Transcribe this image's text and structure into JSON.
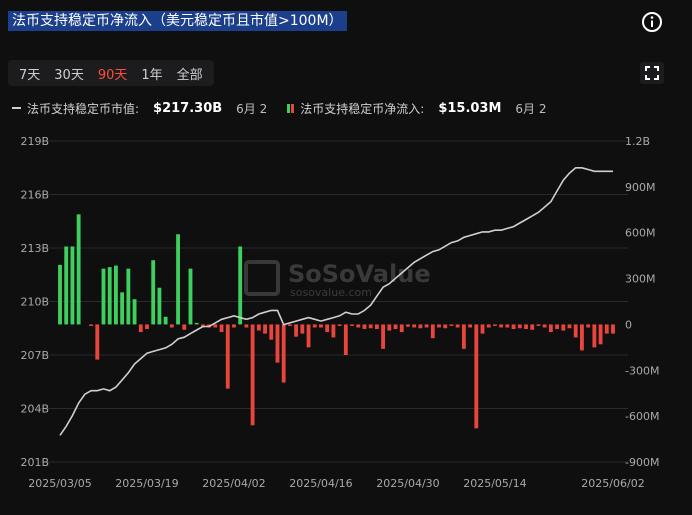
{
  "title": "法币支持稳定币净流入（美元稳定币且市值>100M）",
  "icons": {
    "info": "info-icon",
    "fullscreen": "fullscreen-icon"
  },
  "tabs": [
    {
      "label": "7天",
      "active": false
    },
    {
      "label": "30天",
      "active": false
    },
    {
      "label": "90天",
      "active": true
    },
    {
      "label": "1年",
      "active": false
    },
    {
      "label": "全部",
      "active": false
    }
  ],
  "legend": {
    "marketcap": {
      "label": "法币支持稳定币市值:",
      "value": "$217.30B",
      "date": "6月 2"
    },
    "netflow": {
      "label": "法币支持稳定币净流入:",
      "value": "$15.03M",
      "date": "6月 2"
    }
  },
  "watermark": {
    "brand": "SoSoValue",
    "url": "sosovalue.com"
  },
  "colors": {
    "positive": "#3ecf5e",
    "negative": "#e8453c",
    "line": "#cfcfcf",
    "accent": "#ff4d3a"
  },
  "chart_data": {
    "type": "bar",
    "left_axis": {
      "unit": "B",
      "ylim": [
        201,
        219
      ],
      "ticks": [
        "201B",
        "204B",
        "207B",
        "210B",
        "213B",
        "216B",
        "219B"
      ]
    },
    "right_axis": {
      "unit": "M",
      "ylim": [
        -900,
        1200
      ],
      "ticks": [
        "-900M",
        "-600M",
        "-300M",
        "0",
        "300M",
        "600M",
        "900M",
        "1.2B"
      ]
    },
    "x_ticks": [
      "2025/03/05",
      "2025/03/19",
      "2025/04/02",
      "2025/04/16",
      "2025/04/30",
      "2025/05/14",
      "2025/06/02"
    ],
    "tick_positions": [
      0,
      14,
      28,
      42,
      56,
      70,
      89
    ],
    "grid": true,
    "series": [
      {
        "name": "法币支持稳定币净流入",
        "kind": "bar",
        "axis": "right",
        "values": [
          390,
          510,
          510,
          720,
          0,
          -10,
          -230,
          365,
          375,
          385,
          210,
          365,
          165,
          -50,
          -30,
          420,
          240,
          50,
          -20,
          590,
          -35,
          365,
          10,
          -20,
          -20,
          -20,
          -50,
          -420,
          -20,
          510,
          -20,
          -660,
          -40,
          -60,
          -100,
          -250,
          -380,
          -10,
          -80,
          -60,
          -150,
          -20,
          -20,
          -50,
          -85,
          -10,
          -200,
          -10,
          -20,
          -30,
          -25,
          -30,
          -160,
          -40,
          -30,
          -50,
          -15,
          -20,
          -25,
          -20,
          -90,
          -20,
          -25,
          -10,
          -20,
          -160,
          -20,
          -680,
          -60,
          -20,
          -10,
          -20,
          -20,
          -30,
          -25,
          -30,
          -35,
          -10,
          -20,
          -50,
          -30,
          -40,
          -25,
          -85,
          -170,
          -20,
          -150,
          -130,
          -60,
          -60
        ],
        "note_values": null
      },
      {
        "name": "法币支持稳定币市值",
        "kind": "line",
        "axis": "left",
        "values": [
          202.5,
          203.0,
          203.6,
          204.3,
          204.8,
          205.0,
          205.0,
          205.1,
          205.0,
          205.2,
          205.6,
          206.0,
          206.5,
          206.8,
          207.1,
          207.2,
          207.3,
          207.4,
          207.6,
          207.9,
          208.0,
          208.2,
          208.4,
          208.6,
          208.6,
          208.8,
          209.0,
          209.1,
          209.2,
          209.1,
          209.0,
          209.1,
          209.3,
          209.4,
          209.5,
          209.5,
          208.7,
          208.8,
          208.9,
          209.0,
          209.1,
          209.0,
          208.9,
          209.0,
          209.1,
          209.2,
          209.4,
          209.3,
          209.3,
          209.5,
          209.8,
          210.3,
          210.8,
          211.0,
          211.3,
          211.6,
          211.9,
          212.2,
          212.4,
          212.6,
          212.8,
          212.9,
          213.1,
          213.3,
          213.4,
          213.6,
          213.7,
          213.8,
          213.9,
          213.9,
          214.0,
          214.0,
          214.1,
          214.2,
          214.4,
          214.6,
          214.8,
          215.0,
          215.3,
          215.6,
          216.2,
          216.8,
          217.2,
          217.5,
          217.5,
          217.4,
          217.3,
          217.3,
          217.3,
          217.3
        ]
      }
    ]
  }
}
